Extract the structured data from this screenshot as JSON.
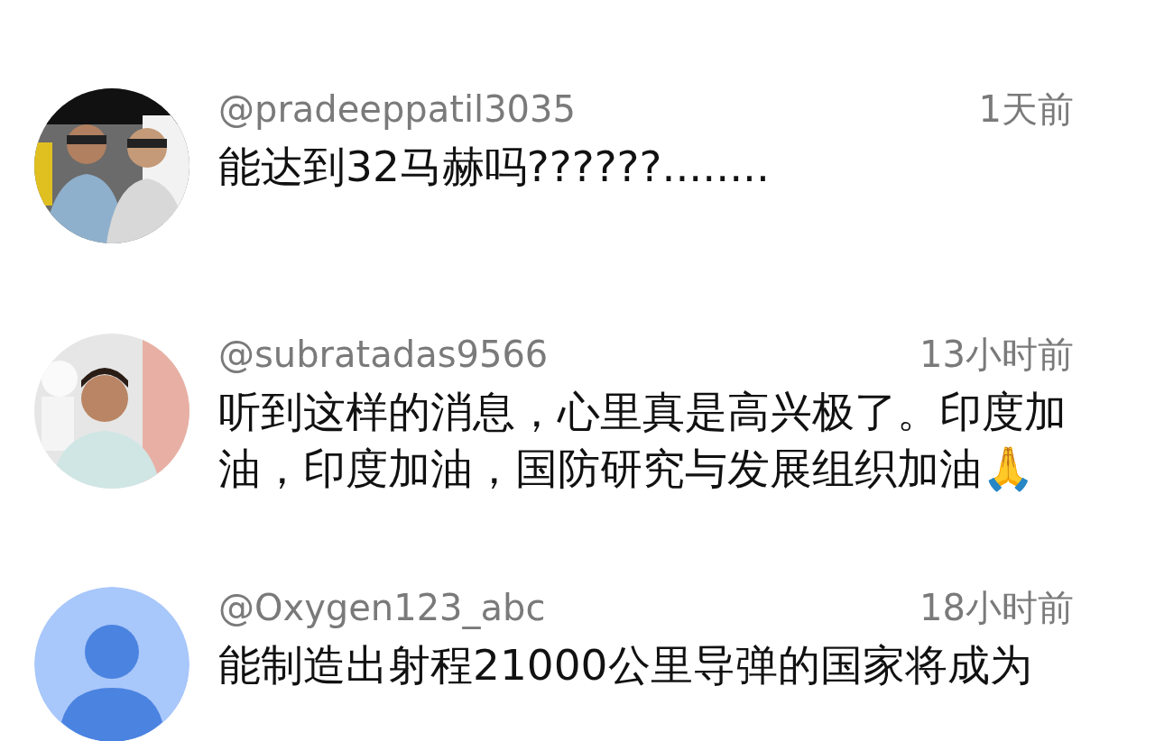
{
  "comments": [
    {
      "username": "@pradeeppatil3035",
      "time": "1天前",
      "text": "能达到32马赫吗??????........"
    },
    {
      "username": "@subratadas9566",
      "time": "13小时前",
      "text": "听到这样的消息，心里真是高兴极了。印度加油，印度加油，国防研究与发展组织加油🙏"
    },
    {
      "username": "@Oxygen123_abc",
      "time": "18小时前",
      "text": "能制造出射程21000公里导弹的国家将成为",
      "avatar": {
        "kind": "default"
      }
    }
  ]
}
